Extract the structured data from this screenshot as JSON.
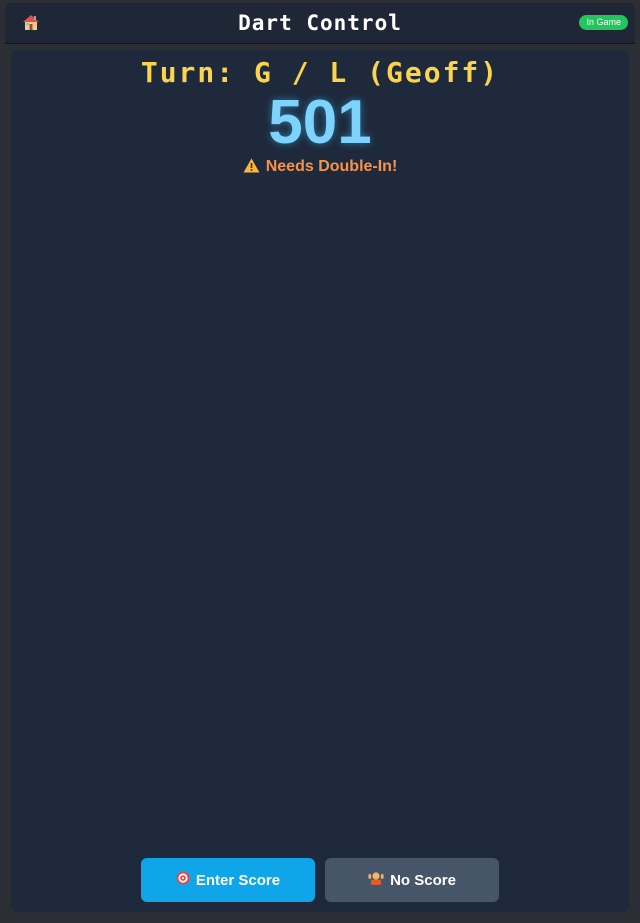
{
  "header": {
    "title": "Dart Control",
    "status": "In Game",
    "status_color": "#22c55e",
    "home_icon": "home-icon"
  },
  "game": {
    "turn_label": "Turn: G / L (Geoff)",
    "score": "501",
    "warning": "Needs Double-In!",
    "warning_icon": "warning-icon"
  },
  "actions": {
    "enter_score": "Enter Score",
    "enter_score_icon": "target-icon",
    "no_score": "No Score",
    "no_score_icon": "shrug-icon"
  },
  "colors": {
    "accent": "#0ea5e9",
    "score": "#7dd3fc",
    "turn": "#fcd34d",
    "warning": "#f6924a"
  }
}
